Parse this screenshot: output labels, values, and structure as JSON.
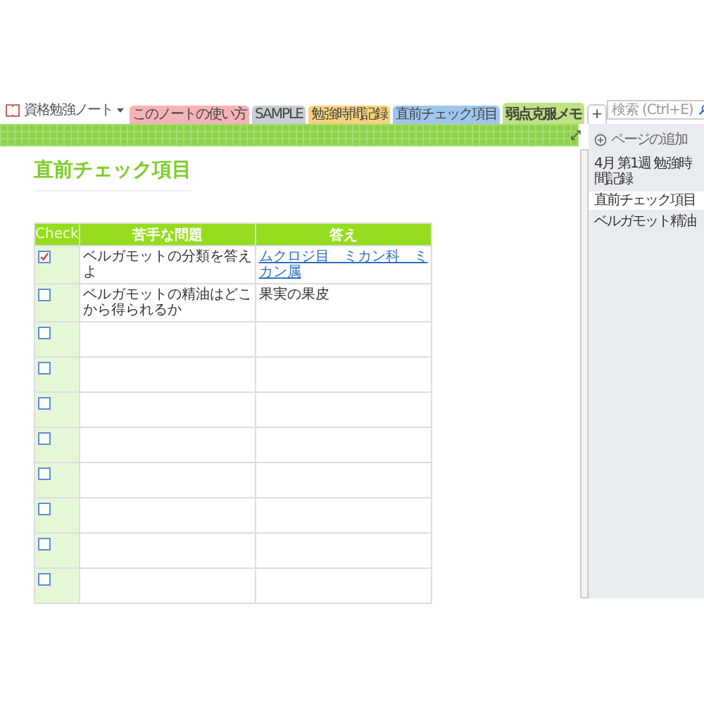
{
  "notebook": {
    "title": "資格勉強ノート"
  },
  "sections": [
    {
      "label": "このノートの使い方",
      "color": "#f4b3b6",
      "selected": false
    },
    {
      "label": "SAMPLE",
      "color": "#c9ced6",
      "selected": false
    },
    {
      "label": "勉強時間記録",
      "color": "#f6d27c",
      "selected": false
    },
    {
      "label": "直前チェック項目",
      "color": "#9ec6ee",
      "selected": false
    },
    {
      "label": "弱点克服メモ",
      "color": "#bfe283",
      "selected": true
    }
  ],
  "add_section": "+",
  "search": {
    "placeholder": "検索 (Ctrl+E)"
  },
  "page": {
    "title": "直前チェック項目"
  },
  "table": {
    "columns": [
      "Check",
      "苦手な問題",
      "答え"
    ],
    "rows": [
      {
        "checked": true,
        "question": "ベルガモットの分類を答えよ",
        "answer": "ムクロジ目　ミカン科　ミカン属",
        "answer_is_link": true
      },
      {
        "checked": false,
        "question": "ベルガモットの精油はどこから得られるか",
        "answer": "果実の果皮",
        "answer_is_link": false
      },
      {
        "checked": false
      },
      {
        "checked": false
      },
      {
        "checked": false
      },
      {
        "checked": false
      },
      {
        "checked": false
      },
      {
        "checked": false
      },
      {
        "checked": false
      },
      {
        "checked": false
      }
    ]
  },
  "pages_pane": {
    "add_page": "ページの追加",
    "pages": [
      {
        "title": "4月 第1週 勉強時間記録",
        "selected": false
      },
      {
        "title": "直前チェック項目",
        "selected": true
      },
      {
        "title": "ベルガモット精油",
        "selected": false
      }
    ]
  }
}
